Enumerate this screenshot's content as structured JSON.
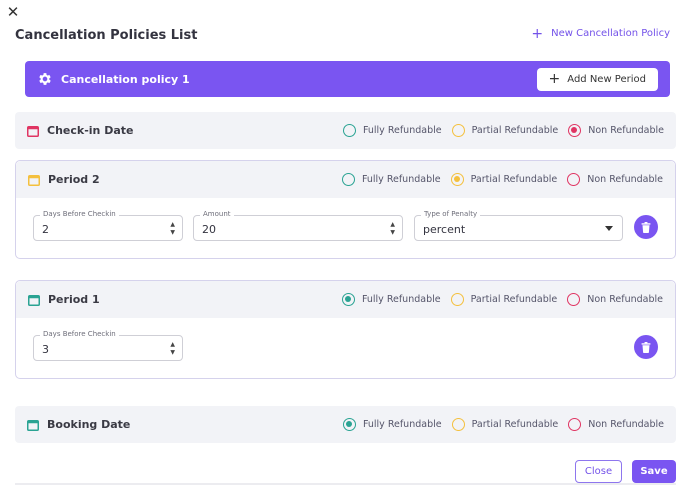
{
  "header": {
    "close_icon": "✕",
    "title": "Cancellation Policies List",
    "new_policy_label": "New Cancellation Policy"
  },
  "policy": {
    "name": "Cancellation policy 1",
    "add_period_label": "Add New Period"
  },
  "refund_options": [
    "Fully Refundable",
    "Partial Refundable",
    "Non Refundable"
  ],
  "checkin": {
    "title": "Check-in Date",
    "icon_color": "#e03563",
    "selected": "Non Refundable"
  },
  "period2": {
    "title": "Period 2",
    "icon_color": "#f4c03e",
    "selected": "Partial Refundable",
    "days_label": "Days Before Checkin",
    "days_value": "2",
    "amount_label": "Amount",
    "amount_value": "20",
    "penalty_label": "Type of Penalty",
    "penalty_value": "percent"
  },
  "period1": {
    "title": "Period 1",
    "icon_color": "#2aa393",
    "selected": "Fully Refundable",
    "days_label": "Days Before Checkin",
    "days_value": "3"
  },
  "booking": {
    "title": "Booking Date",
    "icon_color": "#2aa393",
    "selected": "Fully Refundable"
  },
  "footer": {
    "close_label": "Close",
    "save_label": "Save"
  },
  "colors": {
    "accent": "#7a55f1",
    "fully": "#2aa393",
    "partial": "#f4c03e",
    "non": "#e03563"
  }
}
